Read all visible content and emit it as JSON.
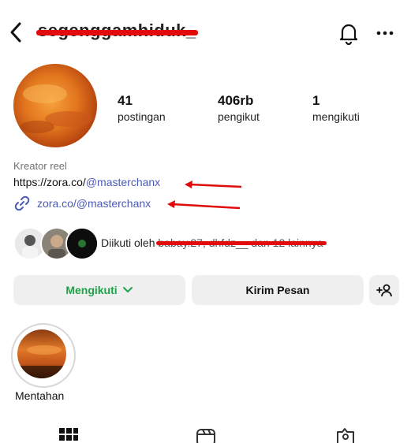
{
  "header": {
    "username": "segenggamhiduk_"
  },
  "stats": [
    {
      "value": "41",
      "label": "postingan"
    },
    {
      "value": "406rb",
      "label": "pengikut"
    },
    {
      "value": "1",
      "label": "mengikuti"
    }
  ],
  "bio": {
    "category": "Kreator reel",
    "link_prefix": "https://zora.co/",
    "link_mention": "@masterchanx",
    "external_link": "zora.co/@masterchanx"
  },
  "followed_by": {
    "prefix": "Diikuti oleh",
    "names": "babay.27, dhfdz__ dan 12 lainnya"
  },
  "actions": {
    "follow_label": "Mengikuti",
    "message_label": "Kirim Pesan"
  },
  "highlight": {
    "label": "Mentahan"
  },
  "colors": {
    "link": "#4b5bb7",
    "follow_green": "#1fa34a",
    "annotation_red": "#e10b0b"
  }
}
